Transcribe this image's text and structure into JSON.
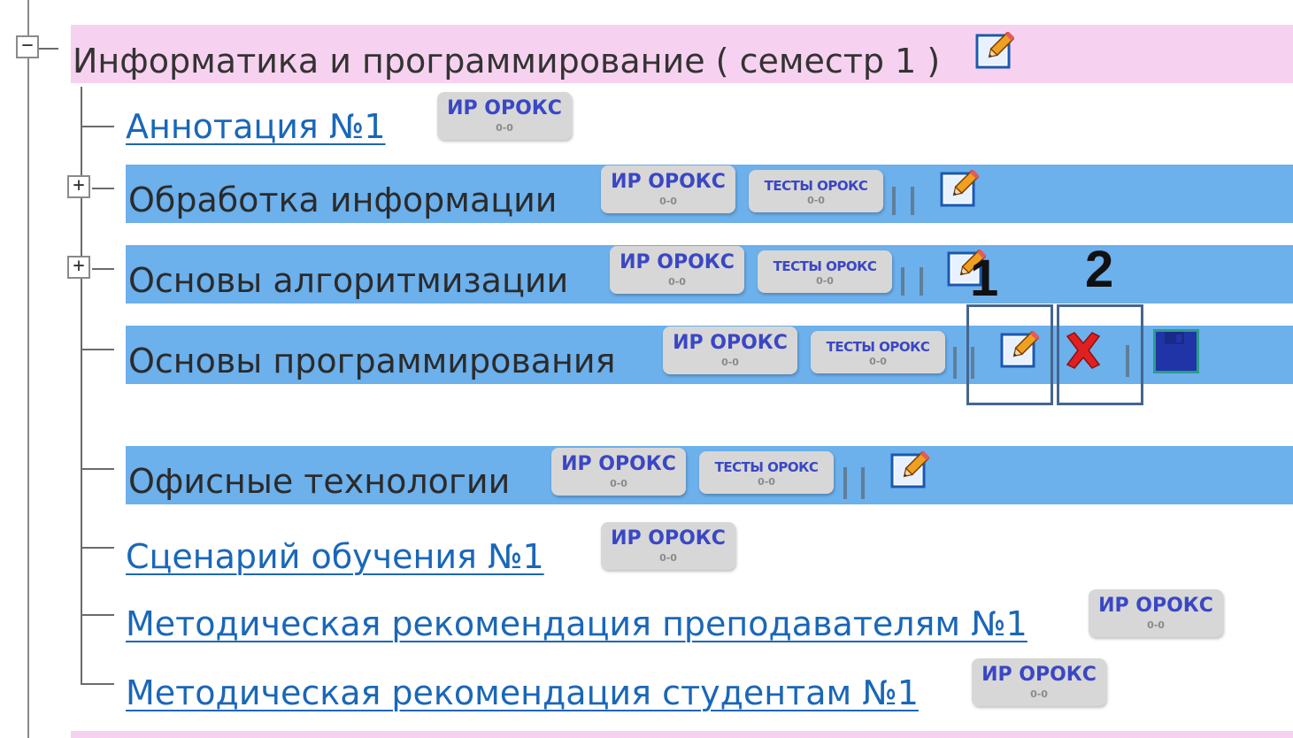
{
  "root": {
    "title": "Информатика и программирование ( семестр 1 )",
    "toggle": "−",
    "edit_icon": "pencil-edit-icon"
  },
  "badge_ir": {
    "label": "ИР ОРОКС",
    "sub": "0-0"
  },
  "badge_test": {
    "label": "ТЕСТЫ ОРОКС",
    "sub": "0-0"
  },
  "items": [
    {
      "label": "Аннотация №1",
      "type": "link"
    },
    {
      "label": "Обработка информации",
      "type": "folder",
      "toggle": "+"
    },
    {
      "label": "Основы алгоритмизации",
      "type": "folder",
      "toggle": "+"
    },
    {
      "label": "Основы программирования",
      "type": "folder-selected"
    },
    {
      "label": "Офисные технологии",
      "type": "folder"
    },
    {
      "label": "Сценарий обучения №1",
      "type": "link"
    },
    {
      "label": "Методическая рекомендация преподавателям №1",
      "type": "link"
    },
    {
      "label": "Методическая рекомендация студентам №1",
      "type": "link"
    }
  ],
  "actions": {
    "edit_icon": "pencil-edit-icon",
    "delete_icon": "red-x-delete-icon",
    "save_icon": "floppy-save-icon"
  },
  "annotations": {
    "marker_1": "1",
    "marker_2": "2"
  },
  "colors": {
    "root_band": "#f7d2f0",
    "folder_band": "#6cb0ec",
    "link": "#1a67b8",
    "badge_text": "#3a47c4",
    "delete": "#e02020"
  }
}
